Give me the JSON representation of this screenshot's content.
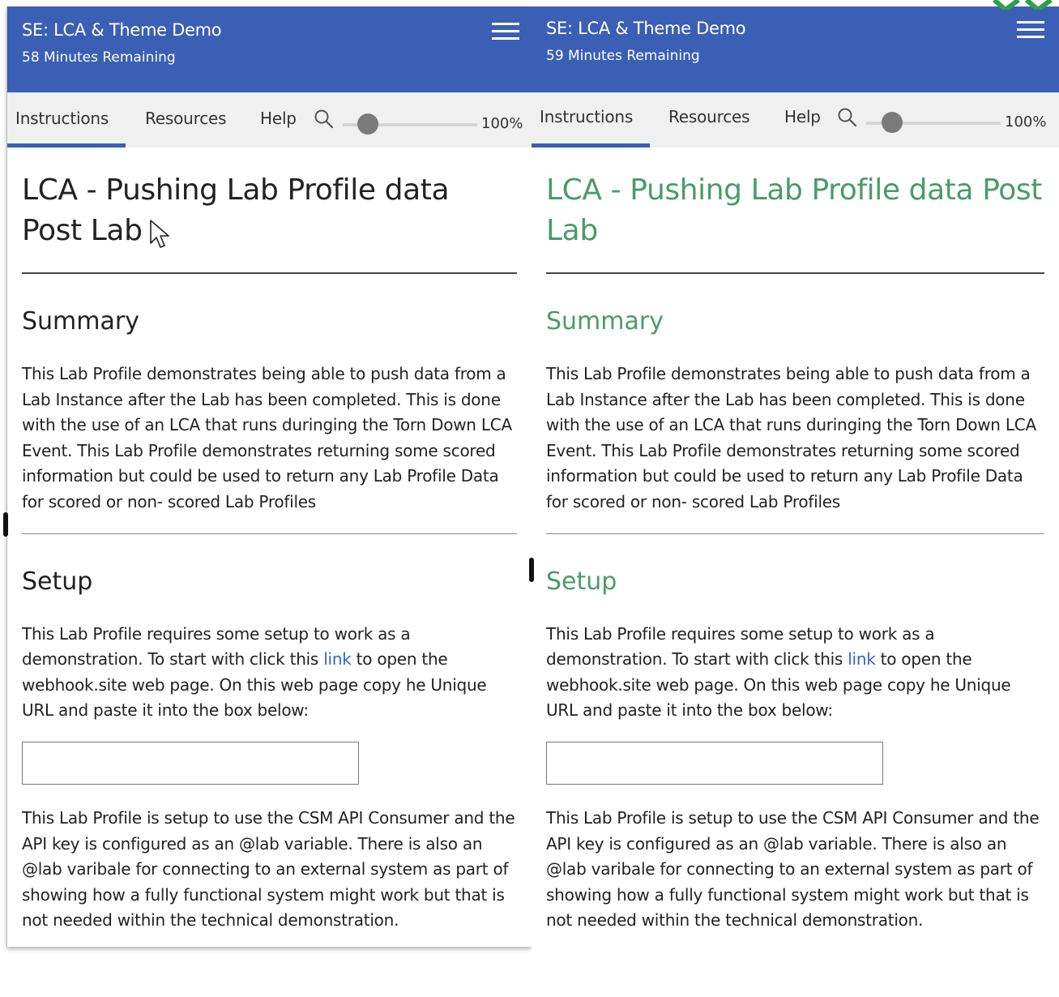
{
  "left": {
    "header": {
      "title": "SE: LCA & Theme Demo",
      "time_remaining": "58 Minutes Remaining"
    },
    "tabs": [
      {
        "label": "Instructions",
        "active": true
      },
      {
        "label": "Resources"
      },
      {
        "label": "Help"
      }
    ],
    "zoom": {
      "percent_label": "100%",
      "value": 100
    },
    "content": {
      "title": "LCA - Pushing Lab Profile data Post Lab",
      "summary": {
        "heading": "Summary",
        "text": "This Lab Profile demonstrates being able to push data from a Lab Instance after the Lab has been completed. This is done with the use of an LCA that runs duringing the Torn Down LCA Event. This Lab Profile demonstrates returning some scored information but could be used to return any Lab Profile Data for scored or non- scored Lab Profiles"
      },
      "setup": {
        "heading": "Setup",
        "text_before_link": "This Lab Profile requires some setup to work as a demonstration. To start with click this ",
        "link_text": "link",
        "text_after_link": " to open the webhook.site web page. On this web page copy he Unique URL and paste it into the box below:",
        "url_input_value": "",
        "text_after_box": "This Lab Profile is setup to use the CSM API Consumer and the API key is configured as an @lab variable. There is also an @lab varibale for connecting to an external system as part of showing how a fully functional system might work but that is not needed within the technical demonstration."
      }
    }
  },
  "right": {
    "header": {
      "title": "SE: LCA & Theme Demo",
      "time_remaining": "59 Minutes Remaining"
    },
    "tabs": [
      {
        "label": "Instructions",
        "active": true
      },
      {
        "label": "Resources"
      },
      {
        "label": "Help"
      }
    ],
    "zoom": {
      "percent_label": "100%",
      "value": 100
    },
    "content": {
      "title": "LCA - Pushing Lab Profile data Post Lab",
      "summary": {
        "heading": "Summary",
        "text": "This Lab Profile demonstrates being able to push data from a Lab Instance after the Lab has been completed. This is done with the use of an LCA that runs duringing the Torn Down LCA Event. This Lab Profile demonstrates returning some scored information but could be used to return any Lab Profile Data for scored or non- scored Lab Profiles"
      },
      "setup": {
        "heading": "Setup",
        "text_before_link": "This Lab Profile requires some setup to work as a demonstration. To start with click this ",
        "link_text": "link",
        "text_after_link": " to open the webhook.site web page. On this web page copy he Unique URL and paste it into the box below:",
        "url_input_value": "",
        "text_after_box": "This Lab Profile is setup to use the CSM API Consumer and the API key is configured as an @lab variable. There is also an @lab varibale for connecting to an external system as part of showing how a fully functional system might work but that is not needed within the technical demonstration."
      }
    }
  },
  "theme": {
    "header_blue": "#3a5fb5",
    "tab_underline": "#3a5fb5",
    "themed_heading_green": "#4b9b6a",
    "link_blue": "#3366cc"
  },
  "icons": {
    "menu": "hamburger-icon",
    "zoom": "magnifier-icon",
    "pointer": "mouse-pointer-icon"
  }
}
